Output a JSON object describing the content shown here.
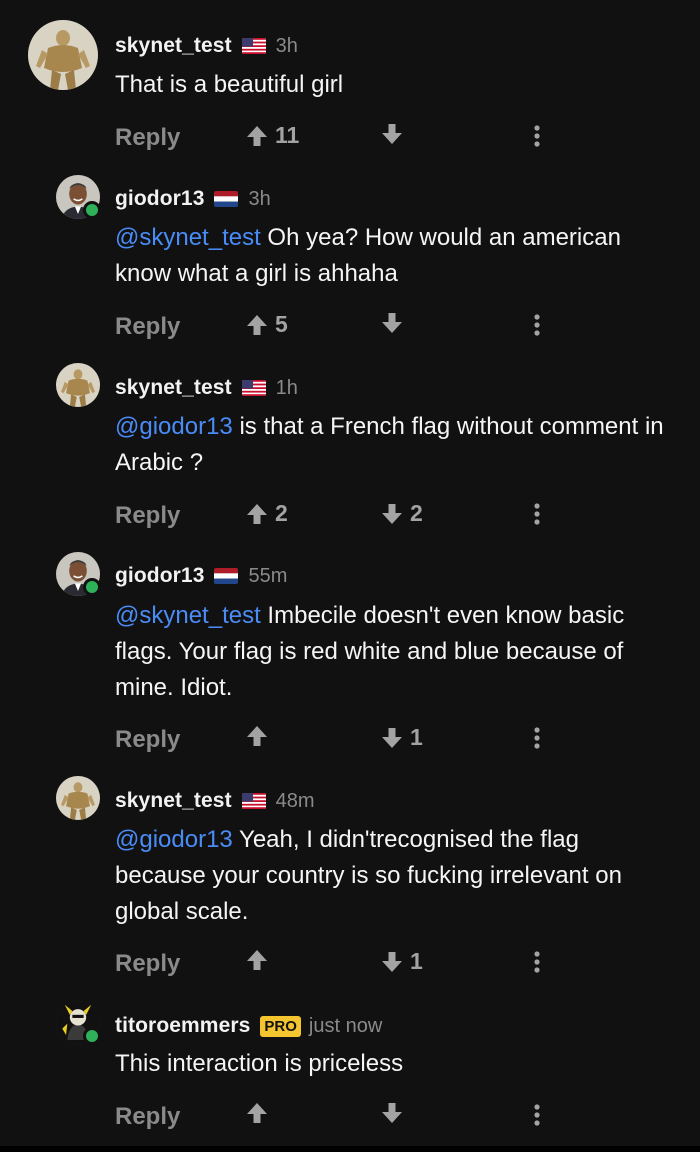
{
  "comments": [
    {
      "username": "skynet_test",
      "flag": "us-flag",
      "time": "3h",
      "mention": "",
      "text": "That is a beautiful girl",
      "reply_label": "Reply",
      "upvotes": "11",
      "downvotes": "",
      "avatar": "statue-avatar",
      "online": false,
      "pro": false
    },
    {
      "username": "giodor13",
      "flag": "nl-flag",
      "time": "3h",
      "mention": "@skynet_test",
      "text": " Oh yea? How would an american know what a girl is ahhaha",
      "reply_label": "Reply",
      "upvotes": "5",
      "downvotes": "",
      "avatar": "man-avatar",
      "online": true,
      "pro": false
    },
    {
      "username": "skynet_test",
      "flag": "us-flag",
      "time": "1h",
      "mention": "@giodor13",
      "text": " is that a French flag without comment in Arabic ?",
      "reply_label": "Reply",
      "upvotes": "2",
      "downvotes": "2",
      "avatar": "statue-avatar",
      "online": false,
      "pro": false
    },
    {
      "username": "giodor13",
      "flag": "nl-flag",
      "time": "55m",
      "mention": "@skynet_test",
      "text": " Imbecile doesn't even know basic flags. Your flag is red white and blue because of mine. Idiot.",
      "reply_label": "Reply",
      "upvotes": "",
      "downvotes": "1",
      "avatar": "man-avatar",
      "online": true,
      "pro": false
    },
    {
      "username": "skynet_test",
      "flag": "us-flag",
      "time": "48m",
      "mention": "@giodor13",
      "text": " Yeah, I didn'trecognised the flag because your country is so fucking irrelevant on global scale.",
      "reply_label": "Reply",
      "upvotes": "",
      "downvotes": "1",
      "avatar": "statue-avatar",
      "online": false,
      "pro": false
    },
    {
      "username": "titoroemmers",
      "flag": "",
      "time": "just now",
      "mention": "",
      "text": "This interaction is priceless",
      "reply_label": "Reply",
      "upvotes": "",
      "downvotes": "",
      "avatar": "cartoon-avatar",
      "online": true,
      "pro": true,
      "pro_label": "PRO"
    }
  ],
  "colors": {
    "background": "#111111",
    "mention": "#4a8cf7",
    "online": "#2fb15a",
    "pro_badge": "#f5c530",
    "muted": "#8a8a8a"
  },
  "icons": [
    "upvote-arrow-icon",
    "downvote-arrow-icon",
    "more-options-icon",
    "us-flag",
    "nl-flag"
  ]
}
